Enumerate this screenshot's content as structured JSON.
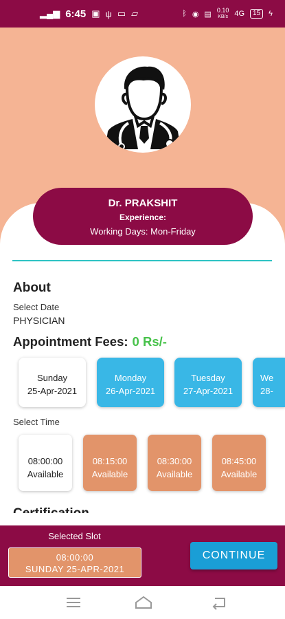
{
  "status_bar": {
    "time": "6:45",
    "network_speed": "0.10",
    "network_unit": "KB/s",
    "signal": "4G",
    "battery": "15"
  },
  "doctor": {
    "name": "Dr. PRAKSHIT",
    "experience_label": "Experience:",
    "working_days": "Working Days:  Mon-Friday"
  },
  "about": {
    "title": "About",
    "select_date_label": "Select Date",
    "speciality": "PHYSICIAN",
    "fees_label": "Appointment Fees:",
    "fees_value": "0 Rs/-"
  },
  "dates": [
    {
      "day": "Sunday",
      "date": "25-Apr-2021",
      "selected": true
    },
    {
      "day": "Monday",
      "date": "26-Apr-2021",
      "selected": false
    },
    {
      "day": "Tuesday",
      "date": "27-Apr-2021",
      "selected": false
    },
    {
      "day": "We",
      "date": "28-",
      "selected": false
    }
  ],
  "select_time_label": "Select Time",
  "times": [
    {
      "time": "08:00:00",
      "status": "Available",
      "selected": true
    },
    {
      "time": "08:15:00",
      "status": "Available",
      "selected": false
    },
    {
      "time": "08:30:00",
      "status": "Available",
      "selected": false
    },
    {
      "time": "08:45:00",
      "status": "Available",
      "selected": false
    }
  ],
  "certification_label": "Certification",
  "bottom": {
    "selected_slot_label": "Selected Slot",
    "slot_time": "08:00:00",
    "slot_date": "SUNDAY 25-APR-2021",
    "continue_label": "CONTINUE"
  },
  "colors": {
    "primary": "#8c0b45",
    "header_bg": "#f5b494",
    "date_unselected": "#39b7e6",
    "time_unselected": "#e2946a",
    "fees_green": "#47c24a",
    "continue": "#1a9ed6"
  }
}
